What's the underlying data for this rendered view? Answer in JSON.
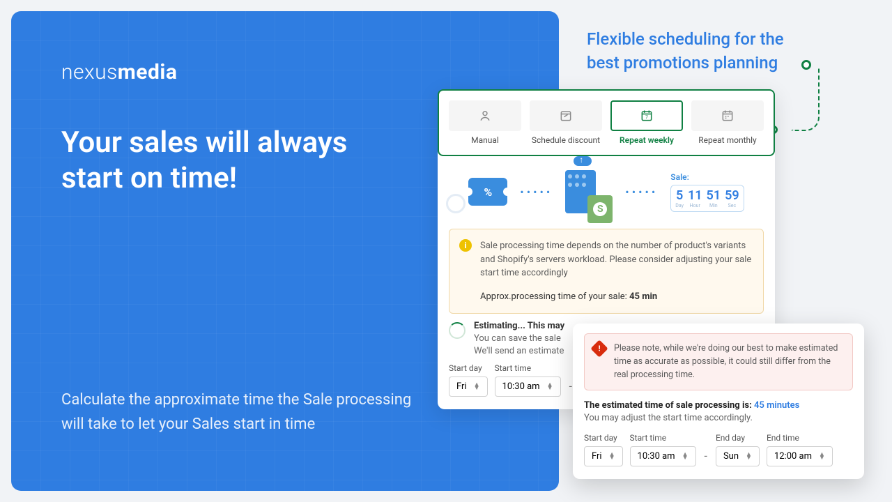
{
  "brand": {
    "part1": "nexus",
    "part2": "media"
  },
  "headline": "Your sales will always start on time!",
  "subtext": "Calculate the approximate time the Sale processing will take to let your Sales start in time",
  "tagline": "Flexible scheduling for the best promotions planning",
  "tabs": {
    "manual": "Manual",
    "schedule": "Schedule discount",
    "weekly": "Repeat weekly",
    "monthly": "Repeat monthly"
  },
  "sale_label": "Sale:",
  "countdown": {
    "d": "5",
    "h": "11",
    "m": "51",
    "s": "59",
    "du": "Day",
    "hu": "Hour",
    "mu": "Min",
    "su": "Sec"
  },
  "warning": {
    "body": "Sale processing time depends on the number of product's variants and Shopify's servers workload. Please consider adjusting your sale start time accordingly",
    "approx_label": "Approx.processing time of your sale: ",
    "approx_value": "45 min"
  },
  "estimating": {
    "title": "Estimating... This may",
    "line1": "You can save the sale",
    "line2": "We'll send an estimate"
  },
  "picker_labels": {
    "start_day": "Start day",
    "start_time": "Start time",
    "end_day": "End day",
    "end_time": "End time"
  },
  "picker1": {
    "day": "Fri",
    "time": "10:30 am"
  },
  "card2": {
    "error": "Please note, while we're doing our best to make estimated time as accurate as possible, it could still differ from the real processing time.",
    "est_pre": "The estimated time of sale processing is: ",
    "est_val": "45 minutes",
    "adjust": "You may adjust the start time accordingly.",
    "picker": {
      "start_day": "Fri",
      "start_time": "10:30 am",
      "end_day": "Sun",
      "end_time": "12:00 am"
    }
  }
}
